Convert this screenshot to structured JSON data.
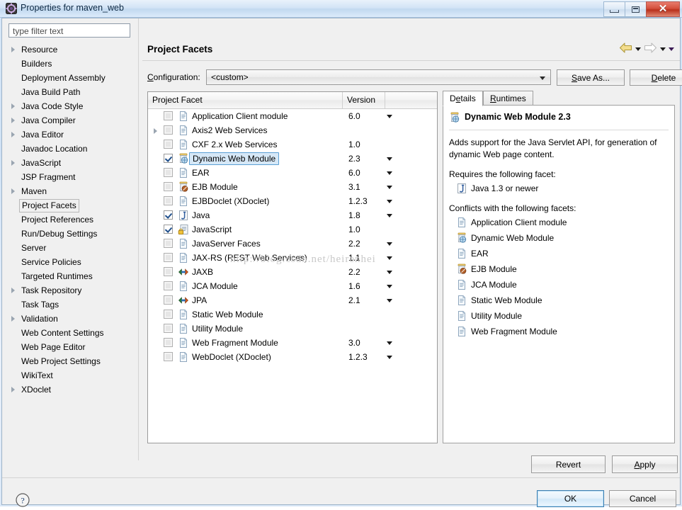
{
  "window": {
    "title": "Properties for maven_web",
    "icon": "eclipse-properties-icon",
    "minimize_label": "Minimize",
    "maximize_label": "Maximize",
    "close_label": "Close"
  },
  "sidebar": {
    "filter_placeholder": "type filter text",
    "filter_value": "",
    "items": [
      {
        "label": "Resource",
        "expandable": true,
        "selected": false
      },
      {
        "label": "Builders",
        "expandable": false,
        "selected": false
      },
      {
        "label": "Deployment Assembly",
        "expandable": false,
        "selected": false
      },
      {
        "label": "Java Build Path",
        "expandable": false,
        "selected": false
      },
      {
        "label": "Java Code Style",
        "expandable": true,
        "selected": false
      },
      {
        "label": "Java Compiler",
        "expandable": true,
        "selected": false
      },
      {
        "label": "Java Editor",
        "expandable": true,
        "selected": false
      },
      {
        "label": "Javadoc Location",
        "expandable": false,
        "selected": false
      },
      {
        "label": "JavaScript",
        "expandable": true,
        "selected": false
      },
      {
        "label": "JSP Fragment",
        "expandable": false,
        "selected": false
      },
      {
        "label": "Maven",
        "expandable": true,
        "selected": false
      },
      {
        "label": "Project Facets",
        "expandable": false,
        "selected": true
      },
      {
        "label": "Project References",
        "expandable": false,
        "selected": false
      },
      {
        "label": "Run/Debug Settings",
        "expandable": false,
        "selected": false
      },
      {
        "label": "Server",
        "expandable": false,
        "selected": false
      },
      {
        "label": "Service Policies",
        "expandable": false,
        "selected": false
      },
      {
        "label": "Targeted Runtimes",
        "expandable": false,
        "selected": false
      },
      {
        "label": "Task Repository",
        "expandable": true,
        "selected": false
      },
      {
        "label": "Task Tags",
        "expandable": false,
        "selected": false
      },
      {
        "label": "Validation",
        "expandable": true,
        "selected": false
      },
      {
        "label": "Web Content Settings",
        "expandable": false,
        "selected": false
      },
      {
        "label": "Web Page Editor",
        "expandable": false,
        "selected": false
      },
      {
        "label": "Web Project Settings",
        "expandable": false,
        "selected": false
      },
      {
        "label": "WikiText",
        "expandable": false,
        "selected": false
      },
      {
        "label": "XDoclet",
        "expandable": true,
        "selected": false
      }
    ]
  },
  "page": {
    "title": "Project Facets",
    "nav": {
      "back_icon": "back-arrow-icon",
      "back_menu_icon": "chevron-down-icon",
      "forward_icon": "forward-arrow-icon",
      "forward_menu_icon": "chevron-down-icon",
      "menu_icon": "chevron-down-icon"
    },
    "configuration": {
      "label": "Configuration:",
      "value": "<custom>",
      "save_as_label": "Save As...",
      "delete_label": "Delete"
    }
  },
  "facets_table": {
    "columns": [
      "Project Facet",
      "Version",
      ""
    ],
    "rows": [
      {
        "checked": false,
        "expandable": false,
        "icon": "document-icon",
        "name": "Application Client module",
        "version": "6.0",
        "has_dropdown": true,
        "selected": false
      },
      {
        "checked": false,
        "expandable": true,
        "icon": "document-icon",
        "name": "Axis2 Web Services",
        "version": "",
        "has_dropdown": false,
        "selected": false
      },
      {
        "checked": false,
        "expandable": false,
        "icon": "document-icon",
        "name": "CXF 2.x Web Services",
        "version": "1.0",
        "has_dropdown": false,
        "selected": false
      },
      {
        "checked": true,
        "expandable": false,
        "icon": "web-module-icon",
        "name": "Dynamic Web Module",
        "version": "2.3",
        "has_dropdown": true,
        "selected": true
      },
      {
        "checked": false,
        "expandable": false,
        "icon": "document-icon",
        "name": "EAR",
        "version": "6.0",
        "has_dropdown": true,
        "selected": false
      },
      {
        "checked": false,
        "expandable": false,
        "icon": "ejb-module-icon",
        "name": "EJB Module",
        "version": "3.1",
        "has_dropdown": true,
        "selected": false
      },
      {
        "checked": false,
        "expandable": false,
        "icon": "document-icon",
        "name": "EJBDoclet (XDoclet)",
        "version": "1.2.3",
        "has_dropdown": true,
        "selected": false
      },
      {
        "checked": true,
        "expandable": false,
        "icon": "java-icon",
        "name": "Java",
        "version": "1.8",
        "has_dropdown": true,
        "selected": false
      },
      {
        "checked": true,
        "expandable": false,
        "icon": "javascript-lock-icon",
        "name": "JavaScript",
        "version": "1.0",
        "has_dropdown": false,
        "selected": false
      },
      {
        "checked": false,
        "expandable": false,
        "icon": "document-icon",
        "name": "JavaServer Faces",
        "version": "2.2",
        "has_dropdown": true,
        "selected": false
      },
      {
        "checked": false,
        "expandable": false,
        "icon": "document-icon",
        "name": "JAX-RS (REST Web Services)",
        "version": "1.1",
        "has_dropdown": true,
        "selected": false
      },
      {
        "checked": false,
        "expandable": false,
        "icon": "jaxb-icon",
        "name": "JAXB",
        "version": "2.2",
        "has_dropdown": true,
        "selected": false
      },
      {
        "checked": false,
        "expandable": false,
        "icon": "document-icon",
        "name": "JCA Module",
        "version": "1.6",
        "has_dropdown": true,
        "selected": false
      },
      {
        "checked": false,
        "expandable": false,
        "icon": "jpa-icon",
        "name": "JPA",
        "version": "2.1",
        "has_dropdown": true,
        "selected": false
      },
      {
        "checked": false,
        "expandable": false,
        "icon": "document-icon",
        "name": "Static Web Module",
        "version": "",
        "has_dropdown": false,
        "selected": false
      },
      {
        "checked": false,
        "expandable": false,
        "icon": "document-icon",
        "name": "Utility Module",
        "version": "",
        "has_dropdown": false,
        "selected": false
      },
      {
        "checked": false,
        "expandable": false,
        "icon": "document-icon",
        "name": "Web Fragment Module",
        "version": "3.0",
        "has_dropdown": true,
        "selected": false
      },
      {
        "checked": false,
        "expandable": false,
        "icon": "document-icon",
        "name": "WebDoclet (XDoclet)",
        "version": "1.2.3",
        "has_dropdown": true,
        "selected": false
      }
    ]
  },
  "details": {
    "tabs": [
      {
        "label": "Details",
        "active": true
      },
      {
        "label": "Runtimes",
        "active": false
      }
    ],
    "heading": "Dynamic Web Module 2.3",
    "heading_icon": "web-module-icon",
    "description": "Adds support for the Java Servlet API, for generation of dynamic Web page content.",
    "requires_label": "Requires the following facet:",
    "requires": [
      {
        "icon": "java-icon",
        "label": "Java 1.3 or newer"
      }
    ],
    "conflicts_label": "Conflicts with the following facets:",
    "conflicts": [
      {
        "icon": "document-icon",
        "label": "Application Client module"
      },
      {
        "icon": "web-module-icon",
        "label": "Dynamic Web Module"
      },
      {
        "icon": "document-icon",
        "label": "EAR"
      },
      {
        "icon": "ejb-module-icon",
        "label": "EJB Module"
      },
      {
        "icon": "document-icon",
        "label": "JCA Module"
      },
      {
        "icon": "document-icon",
        "label": "Static Web Module"
      },
      {
        "icon": "document-icon",
        "label": "Utility Module"
      },
      {
        "icon": "document-icon",
        "label": "Web Fragment Module"
      }
    ]
  },
  "buttons": {
    "revert": "Revert",
    "apply": "Apply",
    "ok": "OK",
    "cancel": "Cancel",
    "help_icon": "help-question-icon"
  },
  "watermark": "http://blog.csdn.net/heirenhei",
  "colors": {
    "accent": "#3c7fb1",
    "selection": "#d6e8f7",
    "titlebar": "#cfe1f5"
  }
}
